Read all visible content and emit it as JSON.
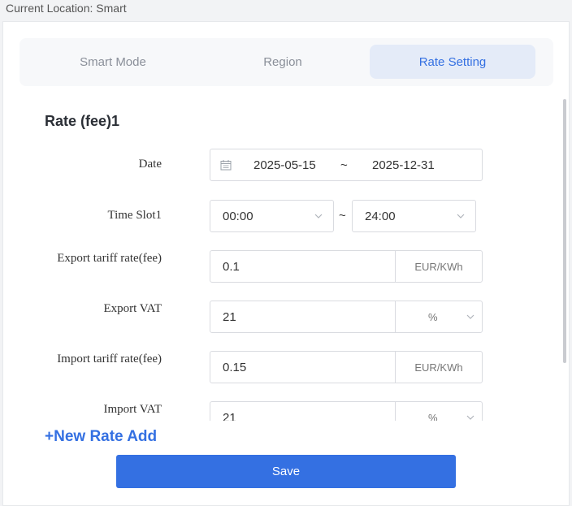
{
  "location": "Current Location: Smart",
  "tabs": [
    {
      "label": "Smart Mode"
    },
    {
      "label": "Region"
    },
    {
      "label": "Rate Setting"
    }
  ],
  "section_title": "Rate (fee)1",
  "date": {
    "label": "Date",
    "start": "2025-05-15",
    "separator": "~",
    "end": "2025-12-31",
    "icon": "calendar-icon"
  },
  "time_slot": {
    "label": "Time Slot1",
    "start": "00:00",
    "separator": "~",
    "end": "24:00"
  },
  "export_tariff": {
    "label": "Export tariff rate(fee)",
    "value": "0.1",
    "unit": "EUR/KWh"
  },
  "export_vat": {
    "label": "Export VAT",
    "value": "21",
    "unit": "%"
  },
  "import_tariff": {
    "label": "Import tariff rate(fee)",
    "value": "0.15",
    "unit": "EUR/KWh"
  },
  "import_vat": {
    "label": "Import VAT",
    "value": "21",
    "unit": "%"
  },
  "new_rate_label": "+New Rate Add",
  "save_label": "Save",
  "colors": {
    "accent": "#3470e2",
    "active_tab_bg": "#e4ebf8",
    "border": "#d9dbe0"
  }
}
